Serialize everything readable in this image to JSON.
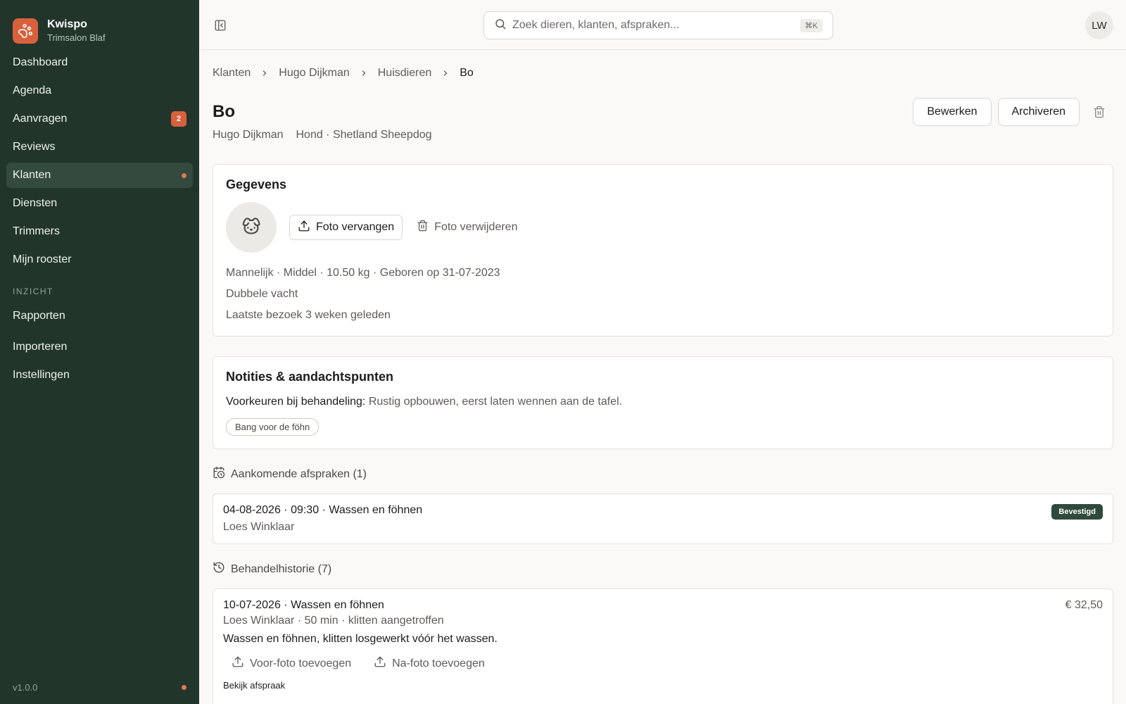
{
  "brand": {
    "name": "Kwispo",
    "subtitle": "Trimsalon Blaf"
  },
  "sidebar": {
    "items": [
      {
        "label": "Dashboard"
      },
      {
        "label": "Agenda"
      },
      {
        "label": "Aanvragen",
        "badge": "2"
      },
      {
        "label": "Reviews"
      },
      {
        "label": "Klanten"
      },
      {
        "label": "Diensten"
      },
      {
        "label": "Trimmers"
      },
      {
        "label": "Mijn rooster"
      }
    ],
    "section_label": "INZICHT",
    "section_items": [
      {
        "label": "Rapporten"
      },
      {
        "label": "Importeren"
      },
      {
        "label": "Instellingen"
      }
    ],
    "version": "v1.0.0",
    "active": "Klanten"
  },
  "topbar": {
    "search_placeholder": "Zoek dieren, klanten, afspraken...",
    "shortcut": "⌘K",
    "avatar_initials": "LW"
  },
  "breadcrumb": [
    "Klanten",
    "Hugo Dijkman",
    "Huisdieren",
    "Bo"
  ],
  "pet": {
    "name": "Bo",
    "owner": "Hugo Dijkman",
    "species_breed": "Hond · Shetland Sheepdog"
  },
  "actions": {
    "edit": "Bewerken",
    "archive": "Archiveren"
  },
  "details": {
    "title": "Gegevens",
    "replace_photo": "Foto vervangen",
    "remove_photo": "Foto verwijderen",
    "attributes": "Mannelijk · Middel · 10.50 kg · Geboren op 31-07-2023",
    "coat": "Dubbele vacht",
    "last_visit": "Laatste bezoek 3 weken geleden"
  },
  "notes": {
    "title": "Notities & aandachtspunten",
    "pref_label": "Voorkeuren bij behandeling:",
    "pref_value": "Rustig opbouwen, eerst laten wennen aan de tafel.",
    "tag": "Bang voor de föhn"
  },
  "upcoming": {
    "heading": "Aankomende afspraken (1)",
    "items": [
      {
        "line": "04-08-2026 · 09:30 · Wassen en föhnen",
        "groomer": "Loes Winklaar",
        "status": "Bevestigd"
      }
    ]
  },
  "history": {
    "heading": "Behandelhistorie (7)",
    "items": [
      {
        "line": "10-07-2026 · Wassen en föhnen",
        "meta": "Loes Winklaar · 50 min · klitten aangetroffen",
        "price": "€ 32,50",
        "description": "Wassen en föhnen, klitten losgewerkt vóór het wassen.",
        "before_photo": "Voor-foto toevoegen",
        "after_photo": "Na-foto toevoegen",
        "view_link": "Bekijk afspraak"
      }
    ]
  },
  "colors": {
    "sidebar_bg": "#22352b",
    "accent": "#d8603d",
    "status_confirmed": "#2f4a3a"
  }
}
